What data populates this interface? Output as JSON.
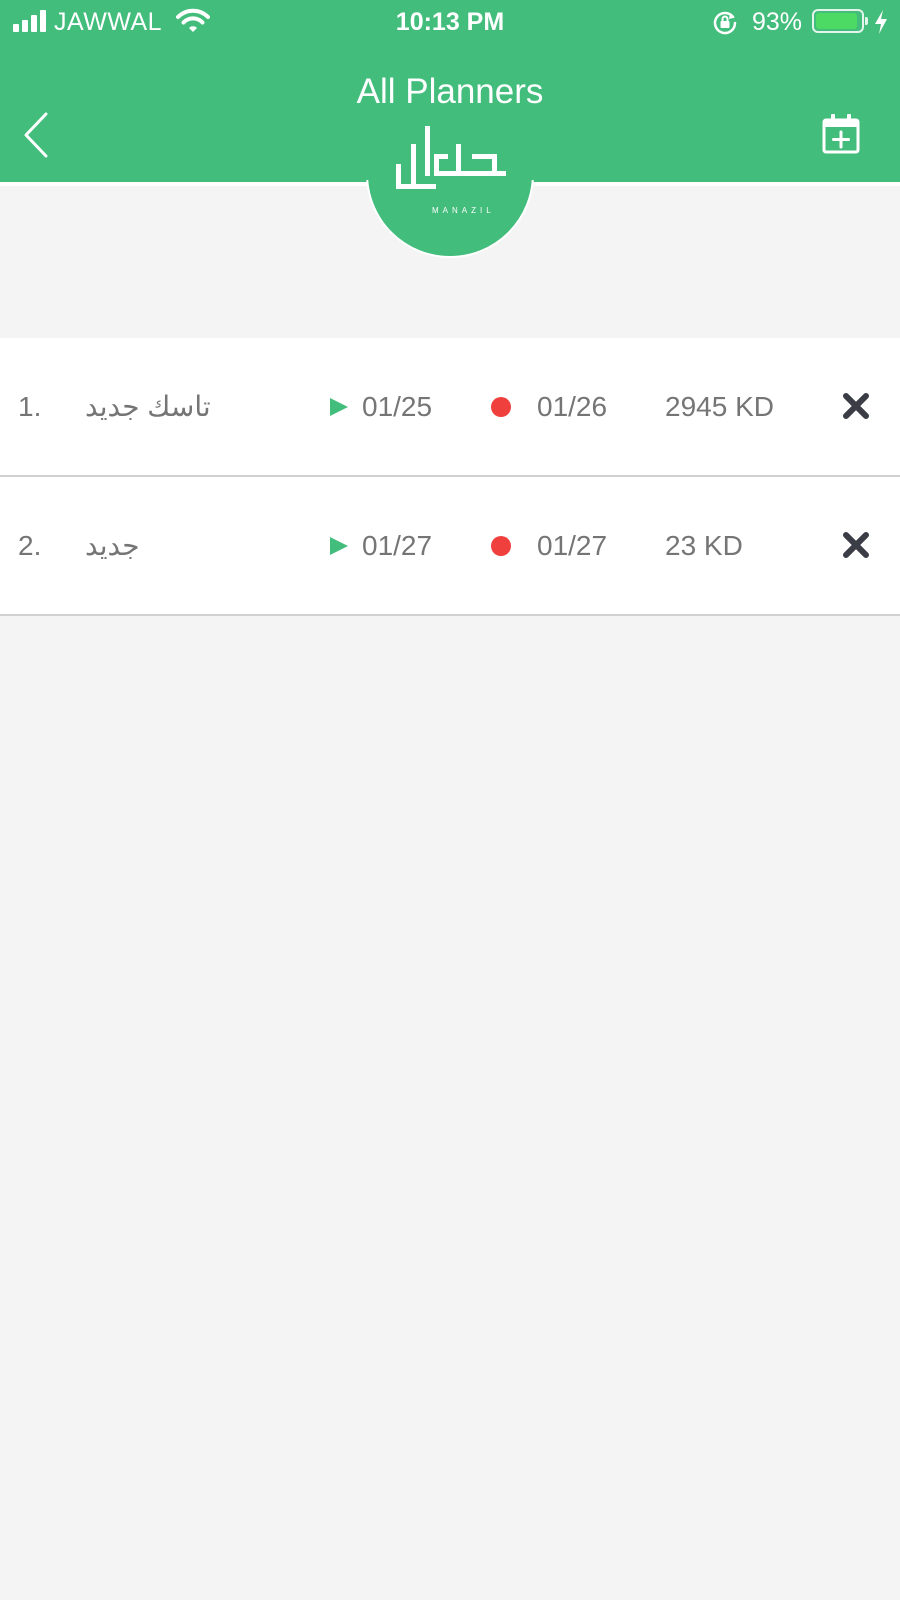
{
  "status_bar": {
    "carrier": "JAWWAL",
    "time": "10:13 PM",
    "battery_percent": "93%",
    "battery_level": 0.93,
    "icons": [
      "signal-icon",
      "wifi-icon",
      "rotation-lock-icon",
      "battery-icon",
      "charging-bolt-icon"
    ]
  },
  "header": {
    "title": "All Planners",
    "back_icon": "chevron-left-icon",
    "add_icon": "calendar-add-icon",
    "logo_text": "MANAZIL",
    "accent_color": "#42bd7b"
  },
  "planners": [
    {
      "number": "1.",
      "name": "تاسك جديد",
      "start_date": "01/25",
      "end_date": "01/26",
      "amount": "2945 KD"
    },
    {
      "number": "2.",
      "name": "جديد",
      "start_date": "01/27",
      "end_date": "01/27",
      "amount": "23 KD"
    }
  ],
  "colors": {
    "start_marker": "#42bd7b",
    "end_marker": "#f0403e",
    "delete_icon": "#3a3d46"
  }
}
